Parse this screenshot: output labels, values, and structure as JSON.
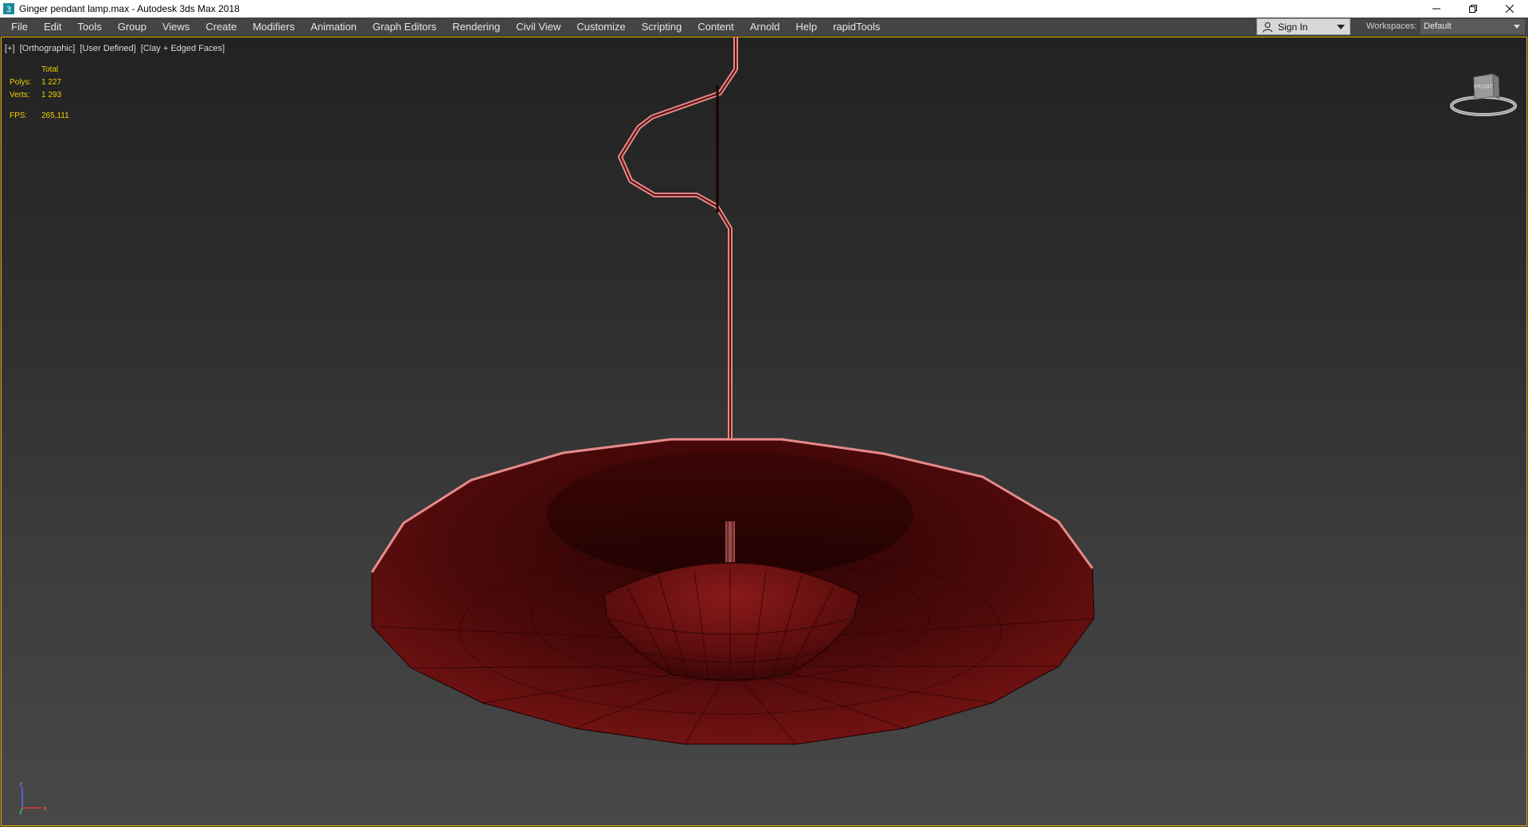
{
  "window": {
    "title": "Ginger pendant lamp.max - Autodesk 3ds Max 2018",
    "icon": "3dsmax-app-icon",
    "controls": [
      "minimize-icon",
      "restore-icon",
      "close-icon"
    ]
  },
  "menubar": {
    "items": [
      "File",
      "Edit",
      "Tools",
      "Group",
      "Views",
      "Create",
      "Modifiers",
      "Animation",
      "Graph Editors",
      "Rendering",
      "Civil View",
      "Customize",
      "Scripting",
      "Content",
      "Arnold",
      "Help",
      "rapidTools"
    ],
    "sign_in": "Sign In",
    "workspaces_label": "Workspaces:",
    "workspace_value": "Default"
  },
  "viewport": {
    "label_plus": "[+]",
    "label_view": "[Orthographic]",
    "label_camera": "[User Defined]",
    "label_shading": "[Clay + Edged Faces]",
    "stats": {
      "header": "Total",
      "polys_label": "Polys:",
      "polys_value": "1 227",
      "verts_label": "Verts:",
      "verts_value": "1 293",
      "fps_label": "FPS:",
      "fps_value": "265,111"
    },
    "viewcube_face": "FRONT",
    "axes": {
      "x": "x",
      "y": "y",
      "z": "z"
    }
  },
  "colors": {
    "viewport_border": "#e0b000",
    "stats_text": "#f0d000",
    "model_dark": "#3a0606",
    "model_mid": "#6a1010",
    "model_light": "#8a1a1a",
    "wire": "#e08080"
  }
}
